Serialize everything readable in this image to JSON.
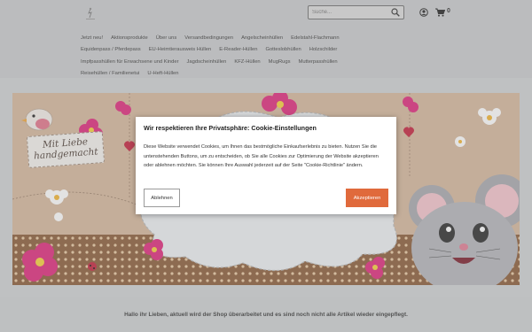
{
  "colors": {
    "accent": "#e06a3c",
    "banner_bg": "#d3b49a",
    "header_bg": "#c9cbcd"
  },
  "header": {
    "search": {
      "placeholder": "Suche..."
    },
    "cart": {
      "count": "0"
    }
  },
  "nav": {
    "rows": [
      [
        "Jetzt neu!",
        "Aktionsprodukte",
        "Über uns",
        "Versandbedingungen",
        "Angelscheinhüllen",
        "Edelstahl-Flachmann"
      ],
      [
        "Equidenpass / Pferdepass",
        "EU-Heimtierausweis Hüllen",
        "E-Reader-Hüllen",
        "Gotteslobhüllen",
        "Holzschilder"
      ],
      [
        "Impfpasshüllen für Erwachsene und Kinder",
        "Jagdscheinhüllen",
        "KFZ-Hüllen",
        "MugRugs",
        "Mutterpasshüllen"
      ],
      [
        "Reisehüllen / Familienetui",
        "U-Heft-Hüllen"
      ]
    ]
  },
  "banner": {
    "text_line1": "Mit Liebe",
    "text_line2": "handgemacht"
  },
  "cookie": {
    "title": "Wir respektieren Ihre Privatsphäre: Cookie-Einstellungen",
    "body": "Diese Website verwendet Cookies, um Ihnen das bestmögliche Einkaufserlebnis zu bieten. Nutzen Sie die untenstehenden Buttons, um zu entscheiden, ob Sie alle Cookies zur Optimierung der Website akzeptieren oder ablehnen möchten. Sie können Ihre Auswahl jederzeit auf der Seite \"Cookie-Richtlinie\" ändern.",
    "decline_label": "Ablehnen",
    "accept_label": "Akzeptieren"
  },
  "notice": {
    "text": "Hallo ihr Lieben, aktuell wird der Shop überarbeitet und es sind noch nicht alle Artikel wieder eingepflegt."
  }
}
